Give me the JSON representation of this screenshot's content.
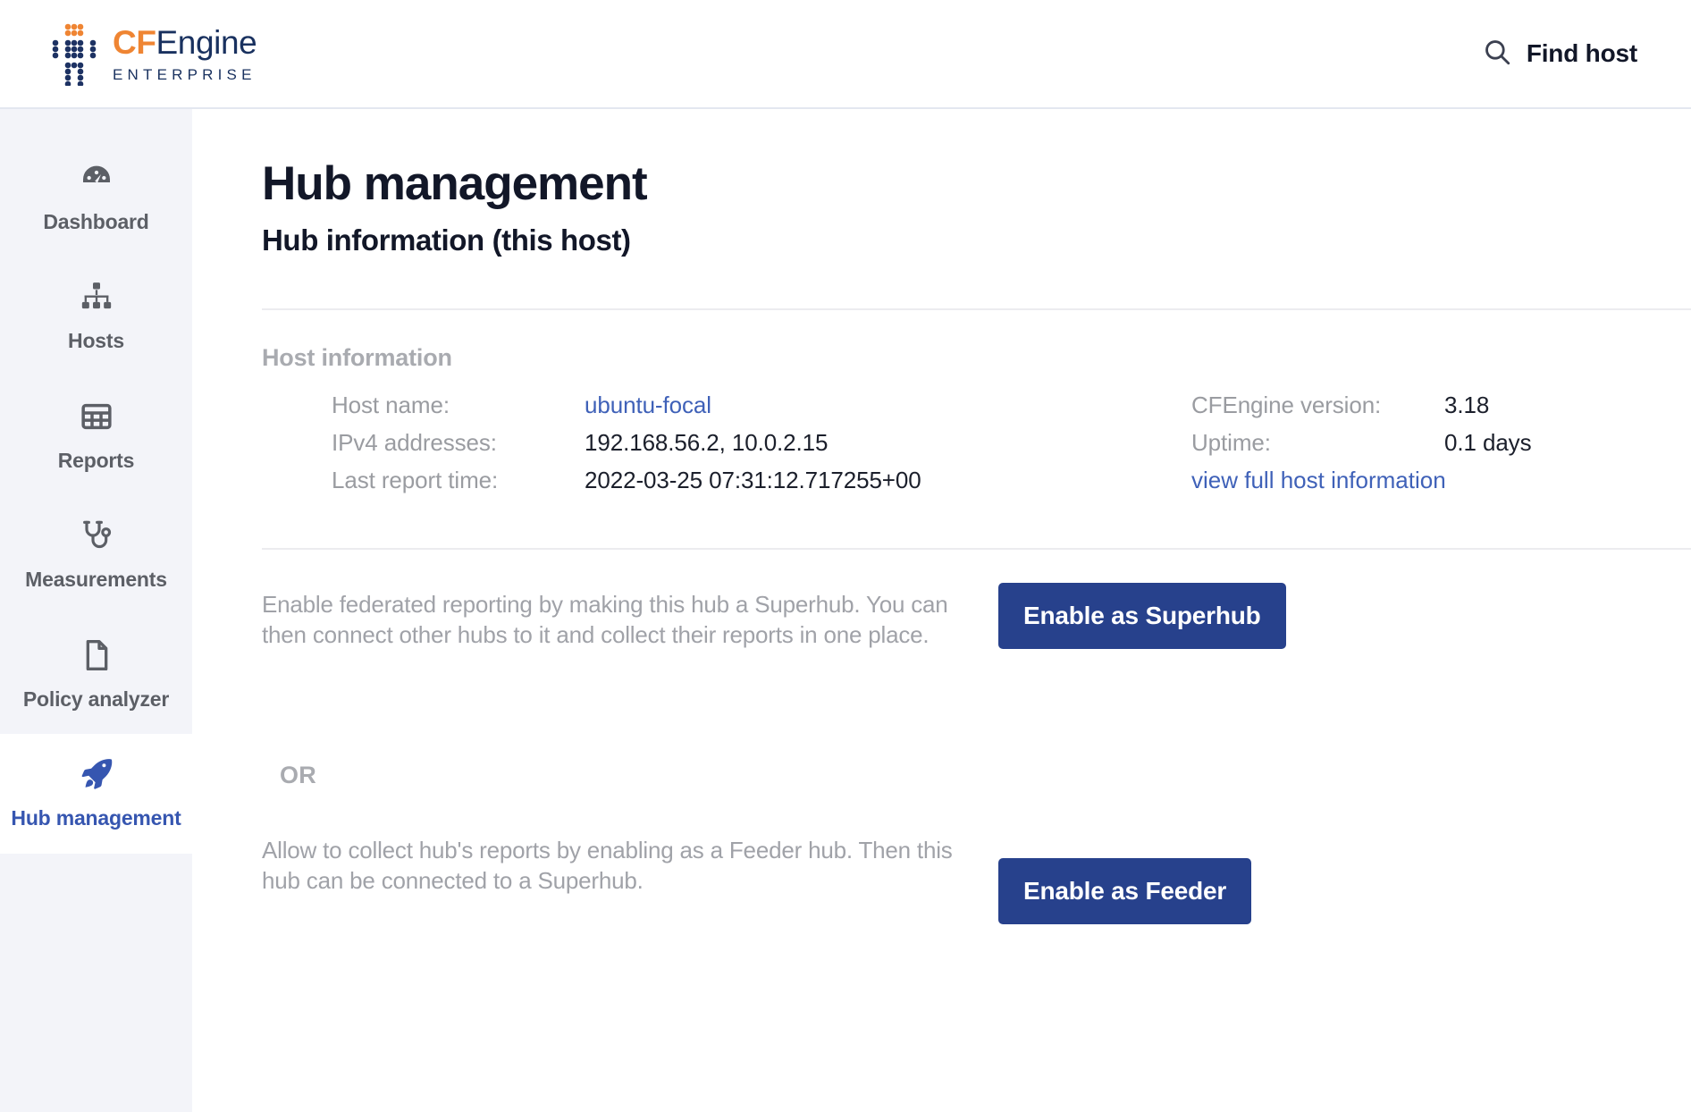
{
  "brand": {
    "name_cf": "CF",
    "name_engine": "Engine",
    "edition": "ENTERPRISE",
    "logo_icon": "cfengine-dots-logo-icon",
    "accent_orange": "#ef8533",
    "accent_navy": "#19315f"
  },
  "header": {
    "find_host_label": "Find host",
    "search_icon": "search-icon"
  },
  "sidebar": {
    "items": [
      {
        "label": "Dashboard",
        "icon": "speedometer-icon",
        "active": false
      },
      {
        "label": "Hosts",
        "icon": "sitemap-icon",
        "active": false
      },
      {
        "label": "Reports",
        "icon": "table-grid-icon",
        "active": false
      },
      {
        "label": "Measurements",
        "icon": "stethoscope-icon",
        "active": false
      },
      {
        "label": "Policy analyzer",
        "icon": "document-icon",
        "active": false
      },
      {
        "label": "Hub management",
        "icon": "rocket-icon",
        "active": true
      }
    ],
    "active_color": "#3656b0",
    "inactive_color": "#5c5f66",
    "background": "#f3f4f9"
  },
  "main": {
    "page_title": "Hub management",
    "page_subtitle": "Hub information (this host)",
    "host_information": {
      "section_label": "Host information",
      "left": [
        {
          "key": "Host name:",
          "value": "ubuntu-focal",
          "is_link": true
        },
        {
          "key": "IPv4 addresses:",
          "value": "192.168.56.2, 10.0.2.15",
          "is_link": false
        },
        {
          "key": "Last report time:",
          "value": "2022-03-25 07:31:12.717255+00",
          "is_link": false
        }
      ],
      "right": [
        {
          "key": "CFEngine version:",
          "value": "3.18",
          "is_link": false
        },
        {
          "key": "Uptime:",
          "value": "0.1 days",
          "is_link": false
        }
      ],
      "full_info_link": "view full host information",
      "link_color": "#3f61b8"
    },
    "superhub": {
      "description": "Enable federated reporting by making this hub a Superhub. You can then connect other hubs to it and collect their reports in one place.",
      "button_label": "Enable as Superhub"
    },
    "or_label": "OR",
    "feeder": {
      "description": "Allow to collect hub's reports by enabling as a Feeder hub. Then this hub can be connected to a Superhub.",
      "button_label": "Enable as Feeder"
    },
    "button_color": "#27418c"
  }
}
